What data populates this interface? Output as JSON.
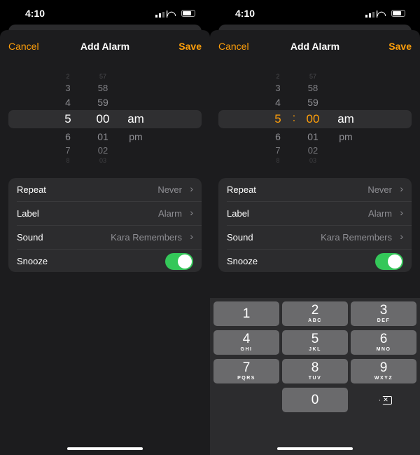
{
  "status": {
    "time": "4:10"
  },
  "nav": {
    "cancel": "Cancel",
    "title": "Add Alarm",
    "save": "Save"
  },
  "picker": {
    "hours": [
      "2",
      "3",
      "4",
      "5",
      "6",
      "7",
      "8"
    ],
    "minutes": [
      "57",
      "58",
      "59",
      "00",
      "01",
      "02",
      "03"
    ],
    "periods": [
      "am",
      "pm"
    ],
    "separator": ":",
    "selected": {
      "hour": "5",
      "minute": "00",
      "period": "am"
    }
  },
  "settings": [
    {
      "label": "Repeat",
      "value": "Never"
    },
    {
      "label": "Label",
      "value": "Alarm"
    },
    {
      "label": "Sound",
      "value": "Kara Remembers"
    },
    {
      "label": "Snooze",
      "toggle": true
    }
  ],
  "keypad": [
    {
      "digit": "1",
      "letters": ""
    },
    {
      "digit": "2",
      "letters": "ABC"
    },
    {
      "digit": "3",
      "letters": "DEF"
    },
    {
      "digit": "4",
      "letters": "GHI"
    },
    {
      "digit": "5",
      "letters": "JKL"
    },
    {
      "digit": "6",
      "letters": "MNO"
    },
    {
      "digit": "7",
      "letters": "PQRS"
    },
    {
      "digit": "8",
      "letters": "TUV"
    },
    {
      "digit": "9",
      "letters": "WXYZ"
    },
    {
      "digit": "0",
      "letters": ""
    }
  ],
  "colors": {
    "accent": "#ff9f0a",
    "toggle_on": "#34c759"
  }
}
